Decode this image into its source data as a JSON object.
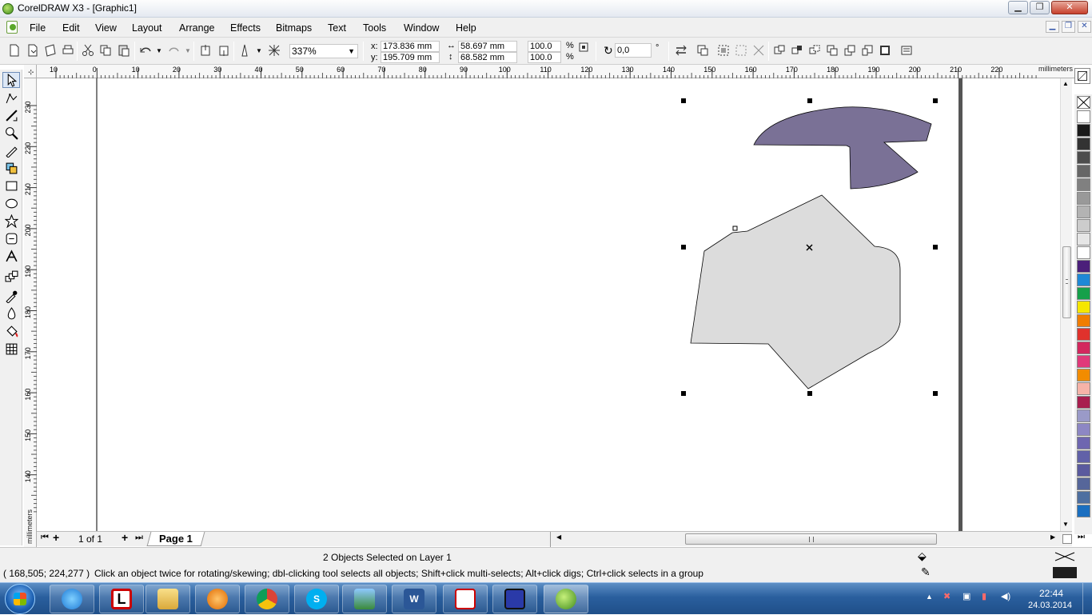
{
  "window": {
    "title": "CorelDRAW X3 - [Graphic1]"
  },
  "menu": {
    "items": [
      "File",
      "Edit",
      "View",
      "Layout",
      "Arrange",
      "Effects",
      "Bitmaps",
      "Text",
      "Tools",
      "Window",
      "Help"
    ]
  },
  "property_bar": {
    "zoom": "337%",
    "x_label": "x:",
    "x_value": "173.836 mm",
    "y_label": "y:",
    "y_value": "195.709 mm",
    "width_value": "58.697 mm",
    "height_value": "68.582 mm",
    "scale_x": "100.0",
    "scale_y": "100.0",
    "percent": "%",
    "rotation": "0,0",
    "degree": "°"
  },
  "ruler": {
    "unit": "millimeters",
    "horizontal_ticks": [
      "10",
      "0",
      "10",
      "20",
      "30",
      "40",
      "50",
      "60",
      "70",
      "80",
      "90",
      "100",
      "110",
      "120",
      "130",
      "140",
      "150",
      "160",
      "170",
      "180",
      "190",
      "200",
      "210",
      "220"
    ],
    "vertical_ticks": [
      "230",
      "220",
      "210",
      "200",
      "190",
      "180",
      "170",
      "160",
      "150",
      "140"
    ]
  },
  "page_nav": {
    "page_count": "1 of 1",
    "tab": "Page 1"
  },
  "status": {
    "selection": "2 Objects Selected on Layer 1",
    "coordinates": "( 168,505; 224,277 )",
    "hint": "Click an object twice for rotating/skewing; dbl-clicking tool selects all objects; Shift+click multi-selects; Alt+click digs; Ctrl+click selects in a group"
  },
  "shapes": {
    "purple_fill": "#7a7196",
    "gray_fill": "#dcdcdc"
  },
  "palette_colors": [
    "#ffffff",
    "#1a1a1a",
    "#333333",
    "#4d4d4d",
    "#666666",
    "#808080",
    "#999999",
    "#b3b3b3",
    "#cccccc",
    "#e6e6e6",
    "#ffffff",
    "#4b1f7a",
    "#1e88d6",
    "#16a04a",
    "#f5e600",
    "#f07d00",
    "#e0322c",
    "#d3285e",
    "#e03a7a",
    "#f28c00",
    "#f6b3a8",
    "#a81e4e",
    "#9a9ac8",
    "#8d87c4",
    "#6e66b0",
    "#6161a8",
    "#5a5a9e",
    "#56669a",
    "#4e6fa0",
    "#1b6fc0"
  ],
  "taskbar": {
    "apps": [
      "ie",
      "lingvo",
      "explorer",
      "media",
      "chrome",
      "skype",
      "photo",
      "word",
      "acrobat",
      "save",
      "coreldraw"
    ],
    "time": "22:44",
    "date": "24.03.2014"
  }
}
